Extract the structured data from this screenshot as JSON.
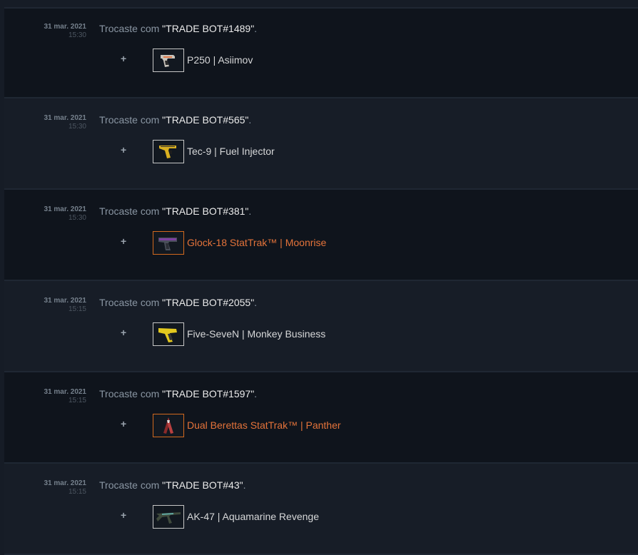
{
  "trade_history": {
    "label_prefix": "Trocaste com ",
    "label_suffix": ".",
    "entries": [
      {
        "date": "31 mar. 2021",
        "time": "15:30",
        "partner": "\"TRADE BOT#1489\"",
        "sign": "+",
        "item": "P250 | Asiimov",
        "item_color": "#d6d7d8",
        "icon": "p250-pistol-icon"
      },
      {
        "date": "31 mar. 2021",
        "time": "15:30",
        "partner": "\"TRADE BOT#565\"",
        "sign": "+",
        "item": "Tec-9 | Fuel Injector",
        "item_color": "#d6d7d8",
        "icon": "tec9-pistol-icon"
      },
      {
        "date": "31 mar. 2021",
        "time": "15:30",
        "partner": "\"TRADE BOT#381\"",
        "sign": "+",
        "item": "Glock-18 StatTrak™ | Moonrise",
        "item_color": "#e4733a",
        "icon": "glock-pistol-icon"
      },
      {
        "date": "31 mar. 2021",
        "time": "15:15",
        "partner": "\"TRADE BOT#2055\"",
        "sign": "+",
        "item": "Five-SeveN | Monkey Business",
        "item_color": "#d6d7d8",
        "icon": "five-seven-pistol-icon"
      },
      {
        "date": "31 mar. 2021",
        "time": "15:15",
        "partner": "\"TRADE BOT#1597\"",
        "sign": "+",
        "item": "Dual Berettas StatTrak™ | Panther",
        "item_color": "#e4733a",
        "icon": "dual-berettas-icon"
      },
      {
        "date": "31 mar. 2021",
        "time": "15:15",
        "partner": "\"TRADE BOT#43\"",
        "sign": "+",
        "item": "AK-47 | Aquamarine Revenge",
        "item_color": "#d6d7d8",
        "icon": "ak47-rifle-icon"
      }
    ]
  }
}
